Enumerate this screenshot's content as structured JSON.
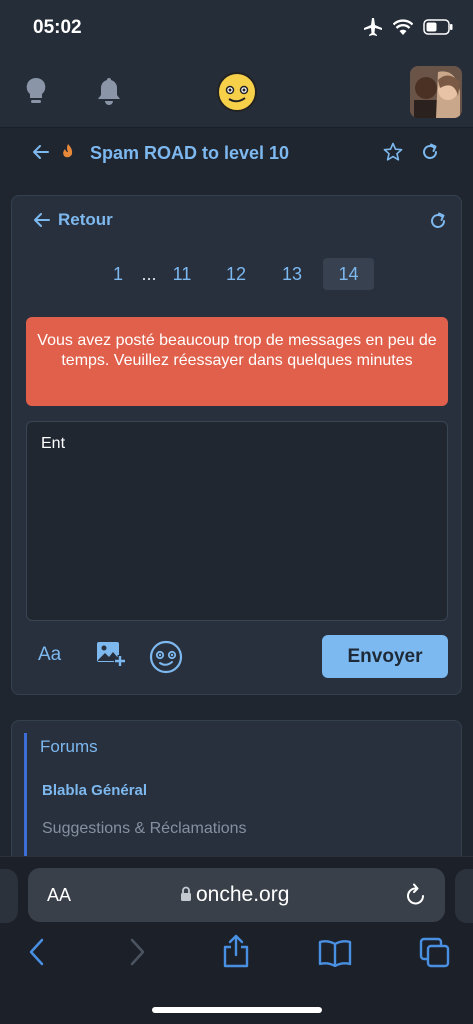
{
  "status": {
    "time": "05:02"
  },
  "topic": {
    "title": "Spam ROAD to level 10"
  },
  "card": {
    "back_label": "Retour",
    "pagination": [
      "1",
      "...",
      "11",
      "12",
      "13",
      "14"
    ],
    "active_page": "14",
    "alert": "Vous avez posté beaucoup trop de messages en peu de temps. Veuillez réessayer dans quelques minutes",
    "message_value": "Ent",
    "toolbar": {
      "format_label": "Aa",
      "send_label": "Envoyer"
    }
  },
  "forums": {
    "title": "Forums",
    "items": [
      "Blabla Général",
      "Suggestions & Réclamations"
    ]
  },
  "browser": {
    "aa_label": "AA",
    "url": "onche.org"
  },
  "colors": {
    "accent": "#7db8ef",
    "alert": "#e0604b",
    "send": "#7cb9f0"
  },
  "icons": [
    "airplane-icon",
    "wifi-icon",
    "battery-icon",
    "lightbulb-icon",
    "bell-icon",
    "smiley-icon",
    "back-arrow-icon",
    "fire-icon",
    "star-icon",
    "refresh-icon",
    "image-add-icon",
    "emoji-icon",
    "lock-icon",
    "reload-icon",
    "chevron-left-icon",
    "chevron-right-icon",
    "share-icon",
    "book-icon",
    "tabs-icon"
  ]
}
